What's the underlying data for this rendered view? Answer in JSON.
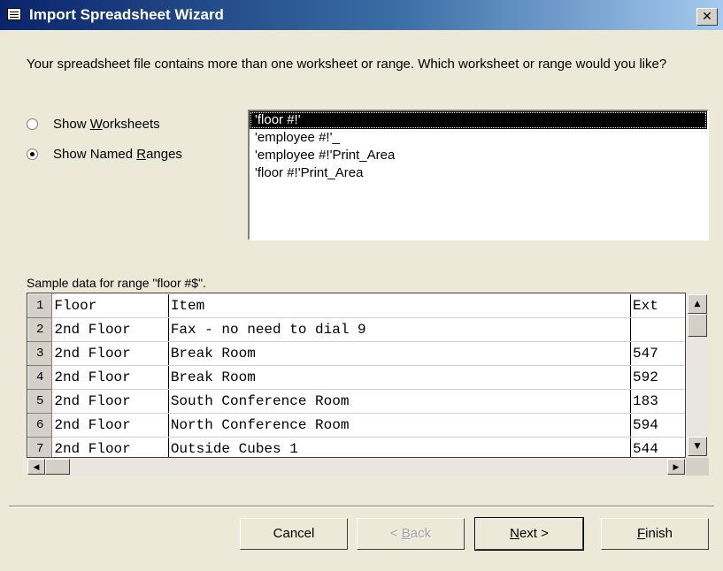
{
  "window": {
    "title": "Import Spreadsheet Wizard",
    "close_symbol": "✕",
    "icon": "form-icon"
  },
  "prompt": "Your spreadsheet file contains more than one worksheet or range. Which worksheet or range would you like?",
  "view_options": {
    "worksheets": {
      "before": "Show ",
      "mnemonic": "W",
      "after": "orksheets",
      "selected": false
    },
    "named_ranges": {
      "before": "Show Named ",
      "mnemonic": "R",
      "after": "anges",
      "selected": true
    }
  },
  "ranges": [
    {
      "label": "'floor #!'",
      "selected": true
    },
    {
      "label": "'employee #!'_",
      "selected": false
    },
    {
      "label": "'employee #!'Print_Area",
      "selected": false
    },
    {
      "label": "'floor #!'Print_Area",
      "selected": false
    }
  ],
  "sample_label": "Sample data for range \"floor #$\".",
  "grid": {
    "rows": [
      {
        "n": "1",
        "c1": "Floor",
        "c2": "Item",
        "c3": "Ext"
      },
      {
        "n": "2",
        "c1": "2nd Floor",
        "c2": "Fax - no need to dial 9",
        "c3": ""
      },
      {
        "n": "3",
        "c1": "2nd Floor",
        "c2": "Break Room",
        "c3": "547"
      },
      {
        "n": "4",
        "c1": "2nd Floor",
        "c2": "Break Room",
        "c3": "592"
      },
      {
        "n": "5",
        "c1": "2nd Floor",
        "c2": "South Conference Room",
        "c3": "183"
      },
      {
        "n": "6",
        "c1": "2nd Floor",
        "c2": "North Conference Room",
        "c3": "594"
      },
      {
        "n": "7",
        "c1": "2nd Floor",
        "c2": "Outside Cubes 1",
        "c3": "544"
      }
    ]
  },
  "buttons": {
    "cancel": {
      "before": "Cancel",
      "mnemonic": "",
      "after": ""
    },
    "back": {
      "before": "< ",
      "mnemonic": "B",
      "after": "ack"
    },
    "next": {
      "before": "",
      "mnemonic": "N",
      "after": "ext >"
    },
    "finish": {
      "before": "",
      "mnemonic": "F",
      "after": "inish"
    }
  }
}
